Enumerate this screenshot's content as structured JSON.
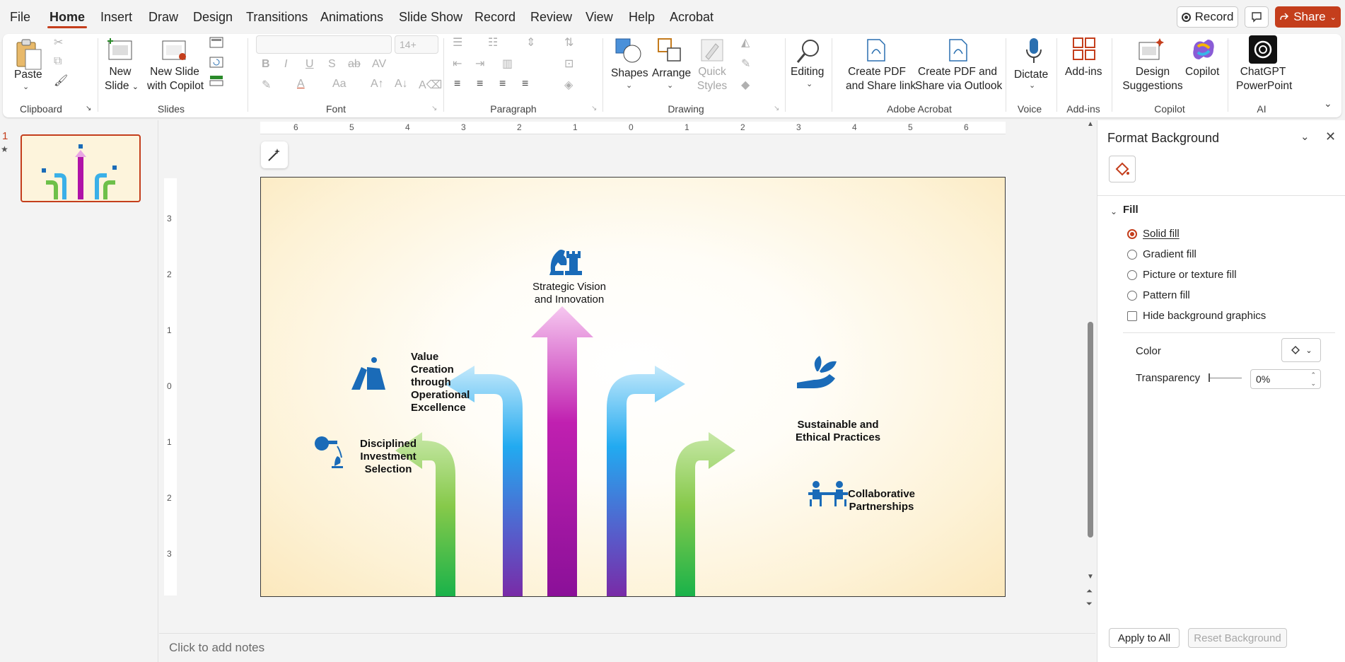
{
  "menu": {
    "tabs": [
      "File",
      "Home",
      "Insert",
      "Draw",
      "Design",
      "Transitions",
      "Animations",
      "Slide Show",
      "Record",
      "Review",
      "View",
      "Help",
      "Acrobat"
    ],
    "active": "Home",
    "record_btn": "Record",
    "share_btn": "Share"
  },
  "ribbon": {
    "clipboard": {
      "paste": "Paste",
      "label": "Clipboard"
    },
    "slides": {
      "new_slide": [
        "New",
        "Slide"
      ],
      "new_slide_copilot": [
        "New Slide",
        "with Copilot"
      ],
      "label": "Slides"
    },
    "font": {
      "font_name": "",
      "font_size": "14+",
      "label": "Font"
    },
    "paragraph": {
      "label": "Paragraph"
    },
    "drawing": {
      "shapes": "Shapes",
      "arrange": "Arrange",
      "quick_styles": [
        "Quick",
        "Styles"
      ],
      "label": "Drawing"
    },
    "editing": {
      "editing": "Editing"
    },
    "acrobat": {
      "create_share": [
        "Create PDF",
        "and Share link"
      ],
      "create_outlook": [
        "Create PDF and",
        "Share via Outlook"
      ],
      "label": "Adobe Acrobat"
    },
    "voice": {
      "dictate": "Dictate",
      "label": "Voice"
    },
    "addins": {
      "addins": "Add-ins",
      "label": "Add-ins"
    },
    "copilot": {
      "design": [
        "Design",
        "Suggestions"
      ],
      "copilot": "Copilot",
      "label": "Copilot"
    },
    "ai": {
      "chatgpt": [
        "ChatGPT",
        "PowerPoint"
      ],
      "label": "AI"
    }
  },
  "thumbnails": {
    "slide_number": "1",
    "star": "★"
  },
  "ruler": {
    "h_ticks": [
      "6",
      "5",
      "4",
      "3",
      "2",
      "1",
      "0",
      "1",
      "2",
      "3",
      "4",
      "5",
      "6"
    ],
    "v_ticks": [
      "3",
      "2",
      "1",
      "0",
      "1",
      "2",
      "3"
    ]
  },
  "slide": {
    "top": [
      "Strategic Vision",
      "and Innovation"
    ],
    "left_upper": [
      "Value",
      "Creation",
      "through",
      "Operational",
      "Excellence"
    ],
    "left_lower": [
      "Disciplined",
      "Investment",
      "Selection"
    ],
    "right_upper": [
      "Sustainable and",
      "Ethical Practices"
    ],
    "right_lower": [
      "Collaborative",
      "Partnerships"
    ]
  },
  "notes": {
    "placeholder": "Click to add notes"
  },
  "format_pane": {
    "title": "Format Background",
    "section": "Fill",
    "options": [
      "Solid fill",
      "Gradient fill",
      "Picture or texture fill",
      "Pattern fill"
    ],
    "selected": "Solid fill",
    "hide_bg": "Hide background graphics",
    "color_label": "Color",
    "transparency_label": "Transparency",
    "transparency_value": "0%",
    "apply_all": "Apply to All",
    "reset": "Reset Background"
  },
  "colors": {
    "accent": "#c43e1c",
    "icon_blue": "#1a6bb8"
  }
}
